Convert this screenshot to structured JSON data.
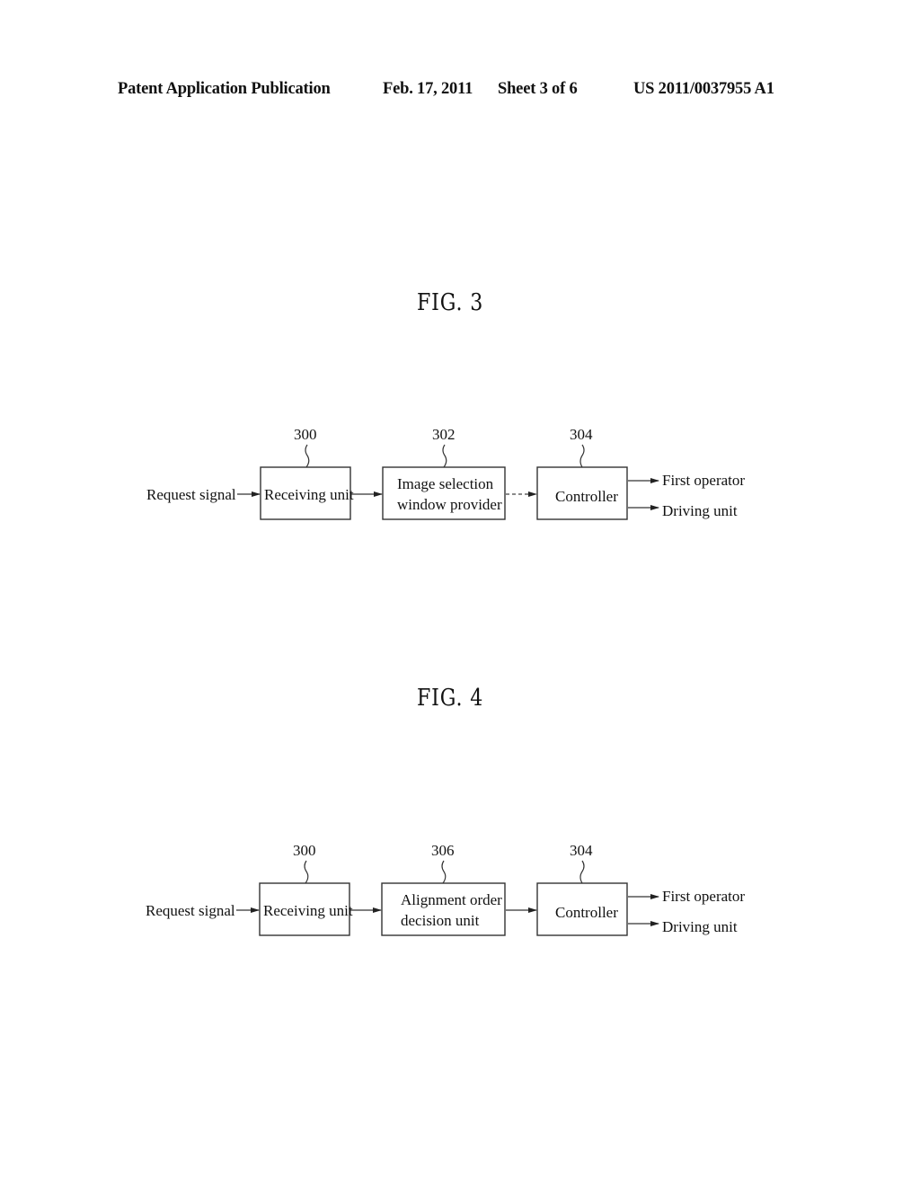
{
  "header": {
    "publication": "Patent Application Publication",
    "date": "Feb. 17, 2011",
    "sheet": "Sheet 3 of 6",
    "number": "US 2011/0037955 A1"
  },
  "fig3": {
    "title": "FIG. 3",
    "input_label": "Request signal",
    "blocks": [
      {
        "ref": "300",
        "line1": "Receiving unit",
        "line2": ""
      },
      {
        "ref": "302",
        "line1": "Image selection",
        "line2": "window provider"
      },
      {
        "ref": "304",
        "line1": "Controller",
        "line2": ""
      }
    ],
    "outputs": [
      "First operator",
      "Driving unit"
    ]
  },
  "fig4": {
    "title": "FIG. 4",
    "input_label": "Request signal",
    "blocks": [
      {
        "ref": "300",
        "line1": "Receiving unit",
        "line2": ""
      },
      {
        "ref": "306",
        "line1": "Alignment order",
        "line2": "decision unit"
      },
      {
        "ref": "304",
        "line1": "Controller",
        "line2": ""
      }
    ],
    "outputs": [
      "First operator",
      "Driving unit"
    ]
  }
}
